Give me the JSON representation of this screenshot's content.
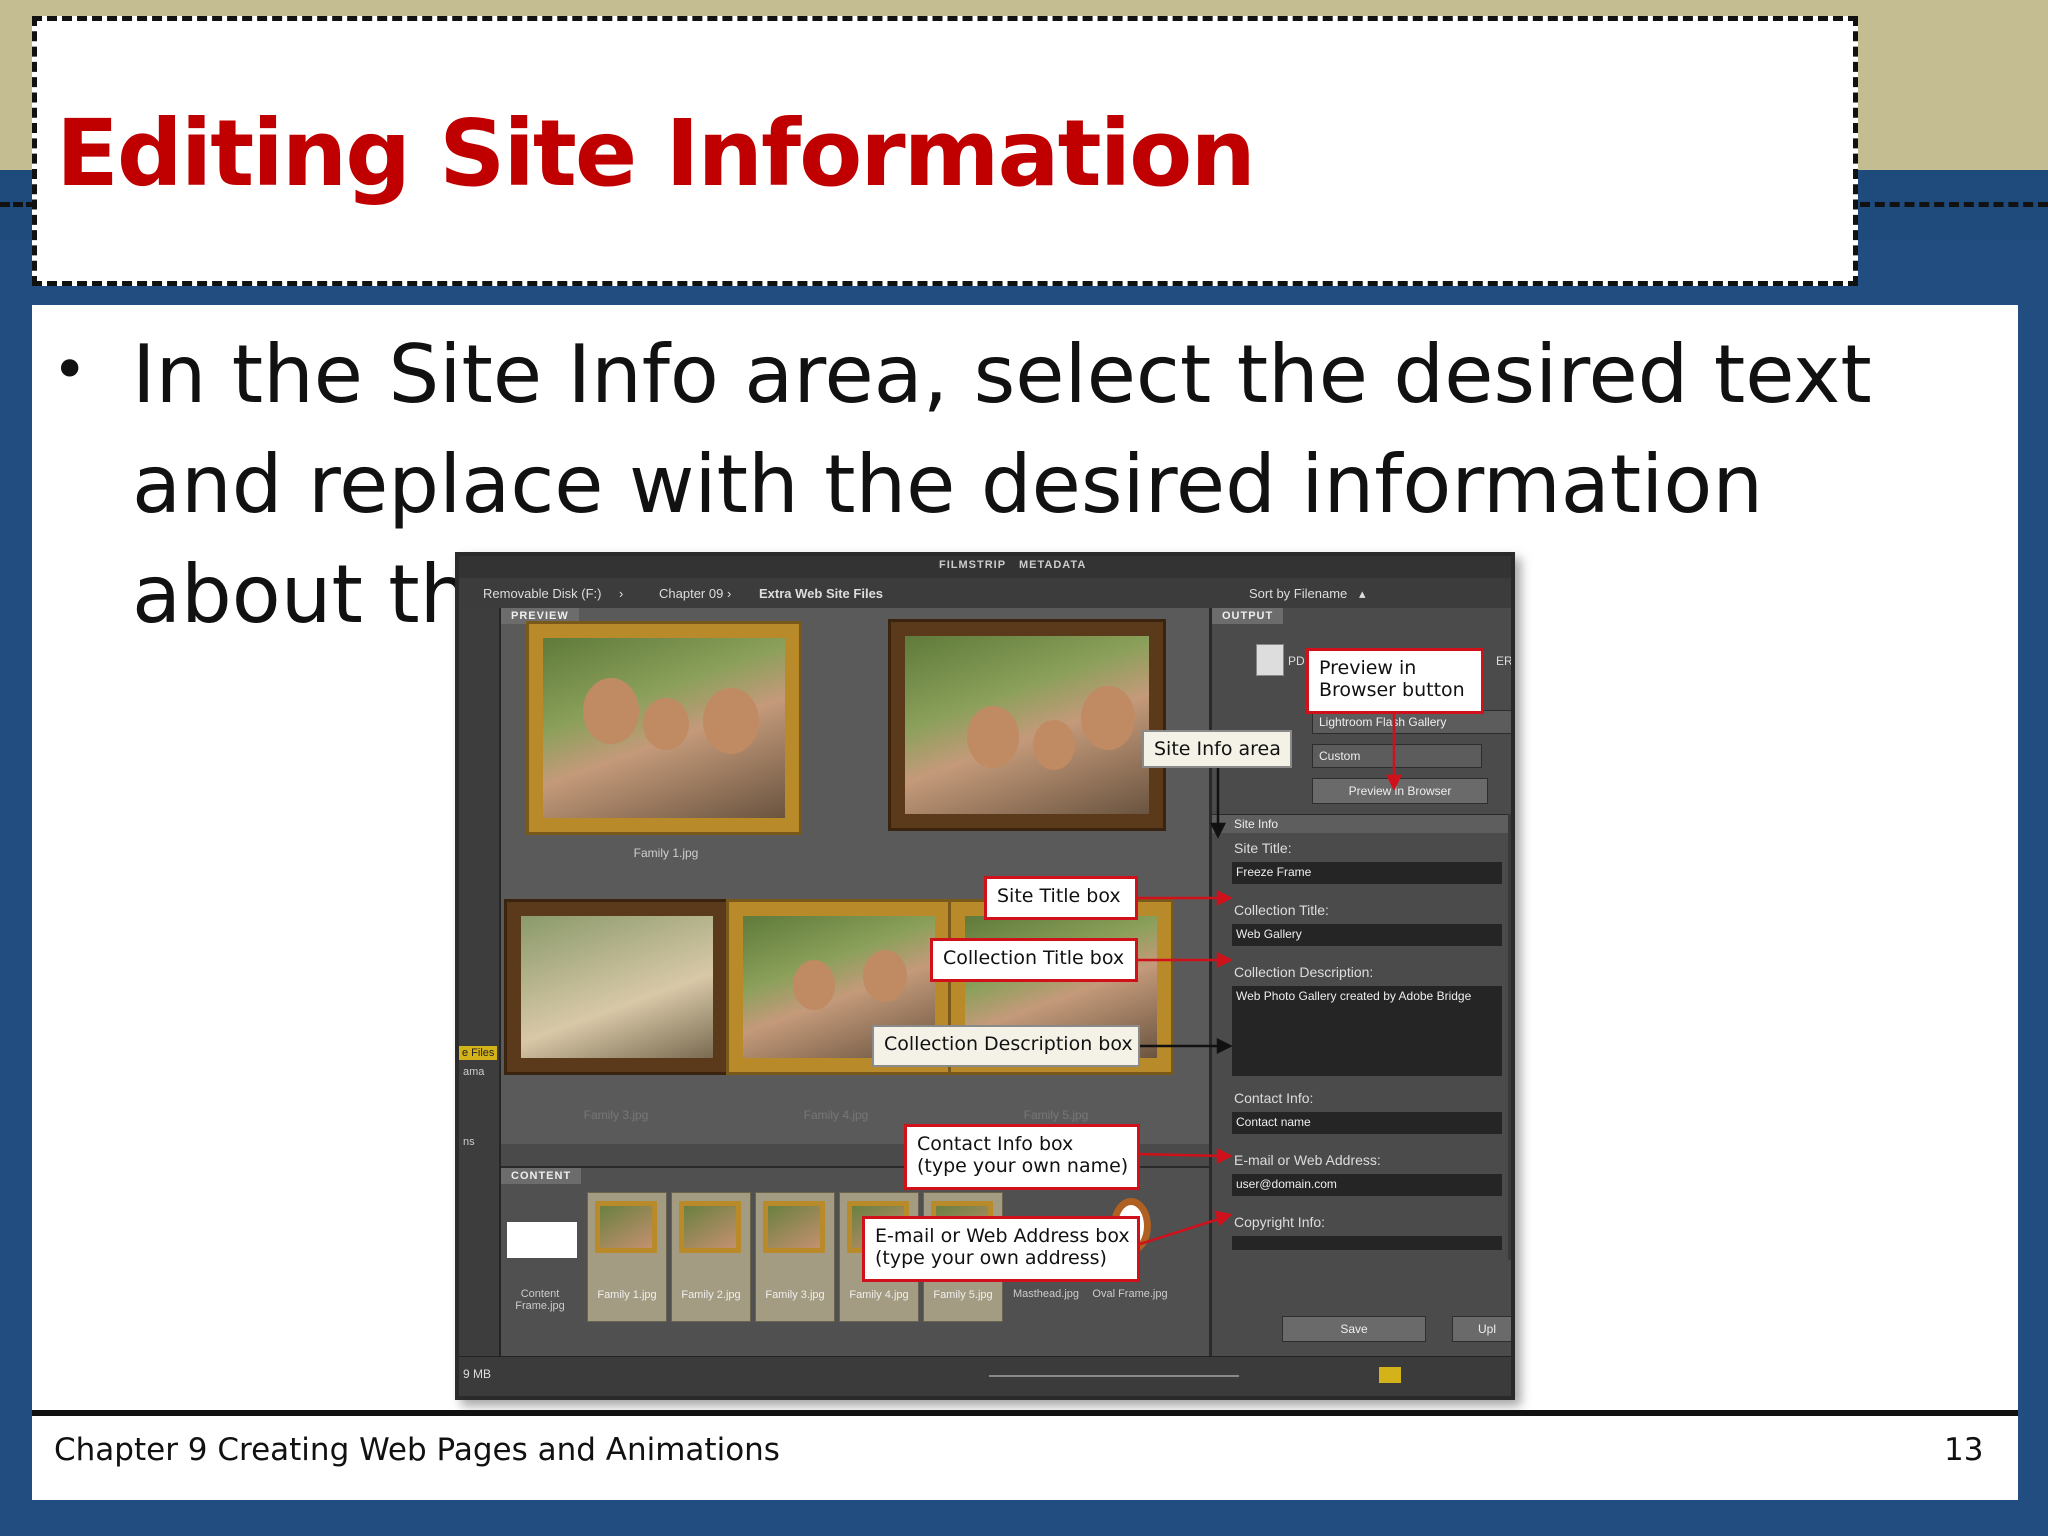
{
  "slide": {
    "title": "Editing Site Information",
    "bullet": "In the Site Info area, select the desired text and replace with the desired information about the site",
    "footer_left": "Chapter 9 Creating Web Pages and Animations",
    "footer_right": "13"
  },
  "colors": {
    "title": "#c00000",
    "band": "#224d80",
    "header": "#c3bd91",
    "callout_border": "#d0101a"
  },
  "bridge": {
    "top_tabs": [
      "FILMSTRIP",
      "METADATA"
    ],
    "path": {
      "drive": "Removable Disk (F:)",
      "folder1": "Chapter 09",
      "folder2": "Extra Web Site Files"
    },
    "sort": "Sort by Filename",
    "panels": {
      "preview": "PREVIEW",
      "content": "CONTENT",
      "output": "OUTPUT"
    },
    "left_labels": {
      "files": "e Files",
      "ama": "ama",
      "ns": "ns"
    },
    "preview_files": [
      "Family 1.jpg",
      "Family 3.jpg",
      "Family 4.jpg",
      "Family 5.jpg"
    ],
    "content_items": [
      "Content Frame.jpg",
      "Family 1.jpg",
      "Family 2.jpg",
      "Family 3.jpg",
      "Family 4.jpg",
      "Family 5.jpg",
      "Masthead.jpg",
      "Oval Frame.jpg"
    ],
    "output": {
      "pdf_label": "PD",
      "gallery_label": "ERY",
      "template": "Lightroom Flash Gallery",
      "style": "Custom",
      "preview_button": "Preview in Browser",
      "site_info_header": "Site Info",
      "site_title_label": "Site Title:",
      "site_title_value": "Freeze Frame",
      "collection_title_label": "Collection Title:",
      "collection_title_value": "Web Gallery",
      "collection_desc_label": "Collection Description:",
      "collection_desc_value": "Web Photo Gallery created by Adobe Bridge",
      "contact_label": "Contact Info:",
      "contact_value": "Contact name",
      "email_label": "E-mail or Web Address:",
      "email_value": "user@domain.com",
      "copyright_label": "Copyright Info:",
      "save_button": "Save",
      "upload_button": "Upl"
    },
    "status": "9 MB"
  },
  "callouts": {
    "preview_button": "Preview in Browser button",
    "site_info": "Site Info area",
    "site_title": "Site Title box",
    "collection_title": "Collection Title box",
    "collection_desc": "Collection Description box",
    "contact_line1": "Contact Info box",
    "contact_line2": "(type your own name)",
    "email_line1": "E-mail or Web Address box",
    "email_line2": "(type your own address)"
  }
}
